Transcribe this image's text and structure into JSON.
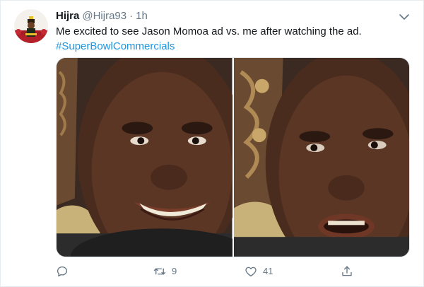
{
  "tweet": {
    "author": {
      "display_name": "Hijra",
      "handle": "@Hijra93",
      "separator": "·",
      "time": "1h",
      "avatar_icon": "avatar-image"
    },
    "text": "Me excited to see Jason Momoa ad vs. me after watching the ad.",
    "hashtag": "#SuperBowlCommercials",
    "media": {
      "panels": [
        {
          "name": "excited-face",
          "description_icon": "meme-excited-panel"
        },
        {
          "name": "disappointed-face",
          "description_icon": "meme-disappointed-panel"
        }
      ]
    },
    "actions": {
      "reply": {
        "icon": "reply-icon",
        "count": ""
      },
      "retweet": {
        "icon": "retweet-icon",
        "count": "9"
      },
      "like": {
        "icon": "heart-icon",
        "count": "41"
      },
      "share": {
        "icon": "share-icon",
        "count": ""
      }
    },
    "menu_icon": "chevron-down-icon"
  },
  "colors": {
    "text_primary": "#14171a",
    "text_secondary": "#657786",
    "link": "#1b95e0",
    "border": "#e6ecf0"
  }
}
